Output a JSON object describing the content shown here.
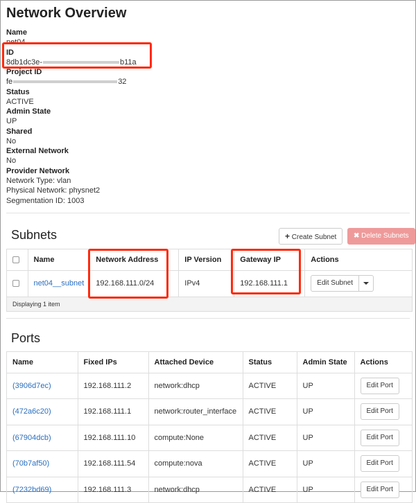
{
  "overview": {
    "title": "Network Overview",
    "fields": [
      {
        "label": "Name",
        "value": "net04"
      },
      {
        "label": "ID",
        "value_prefix": "8db1dc3e-",
        "value_suffix": "b11a",
        "masked": true
      },
      {
        "label": "Project ID",
        "value_prefix": "fe",
        "value_suffix": "32",
        "masked": true
      },
      {
        "label": "Status",
        "value": "ACTIVE"
      },
      {
        "label": "Admin State",
        "value": "UP"
      },
      {
        "label": "Shared",
        "value": "No"
      },
      {
        "label": "External Network",
        "value": "No"
      }
    ],
    "provider": {
      "label": "Provider Network",
      "network_type": "Network Type: vlan",
      "physical_network": "Physical Network: physnet2",
      "segmentation_id": "Segmentation ID: 1003"
    }
  },
  "subnets": {
    "heading": "Subnets",
    "create_label": "Create Subnet",
    "delete_label": "Delete Subnets",
    "columns": [
      "Name",
      "Network Address",
      "IP Version",
      "Gateway IP",
      "Actions"
    ],
    "rows": [
      {
        "name": "net04__subnet",
        "network_address": "192.168.111.0/24",
        "ip_version": "IPv4",
        "gateway_ip": "192.168.111.1",
        "action": "Edit Subnet"
      }
    ],
    "footer": "Displaying 1 item"
  },
  "ports": {
    "heading": "Ports",
    "columns": [
      "Name",
      "Fixed IPs",
      "Attached Device",
      "Status",
      "Admin State",
      "Actions"
    ],
    "rows": [
      {
        "name": "(3906d7ec)",
        "fixed_ip": "192.168.111.2",
        "device": "network:dhcp",
        "status": "ACTIVE",
        "admin_state": "UP",
        "action": "Edit Port"
      },
      {
        "name": "(472a6c20)",
        "fixed_ip": "192.168.111.1",
        "device": "network:router_interface",
        "status": "ACTIVE",
        "admin_state": "UP",
        "action": "Edit Port"
      },
      {
        "name": "(67904dcb)",
        "fixed_ip": "192.168.111.10",
        "device": "compute:None",
        "status": "ACTIVE",
        "admin_state": "UP",
        "action": "Edit Port"
      },
      {
        "name": "(70b7af50)",
        "fixed_ip": "192.168.111.54",
        "device": "compute:nova",
        "status": "ACTIVE",
        "admin_state": "UP",
        "action": "Edit Port"
      },
      {
        "name": "(7232bd69)",
        "fixed_ip": "192.168.111.3",
        "device": "network:dhcp",
        "status": "ACTIVE",
        "admin_state": "UP",
        "action": "Edit Port"
      }
    ]
  },
  "colors": {
    "link": "#2a6fbf",
    "highlight": "#ff2a0f",
    "danger_button": "#ef9a9a"
  },
  "icons": {
    "create": "plus-icon",
    "delete": "close-icon",
    "dropdown": "caret-down-icon"
  }
}
